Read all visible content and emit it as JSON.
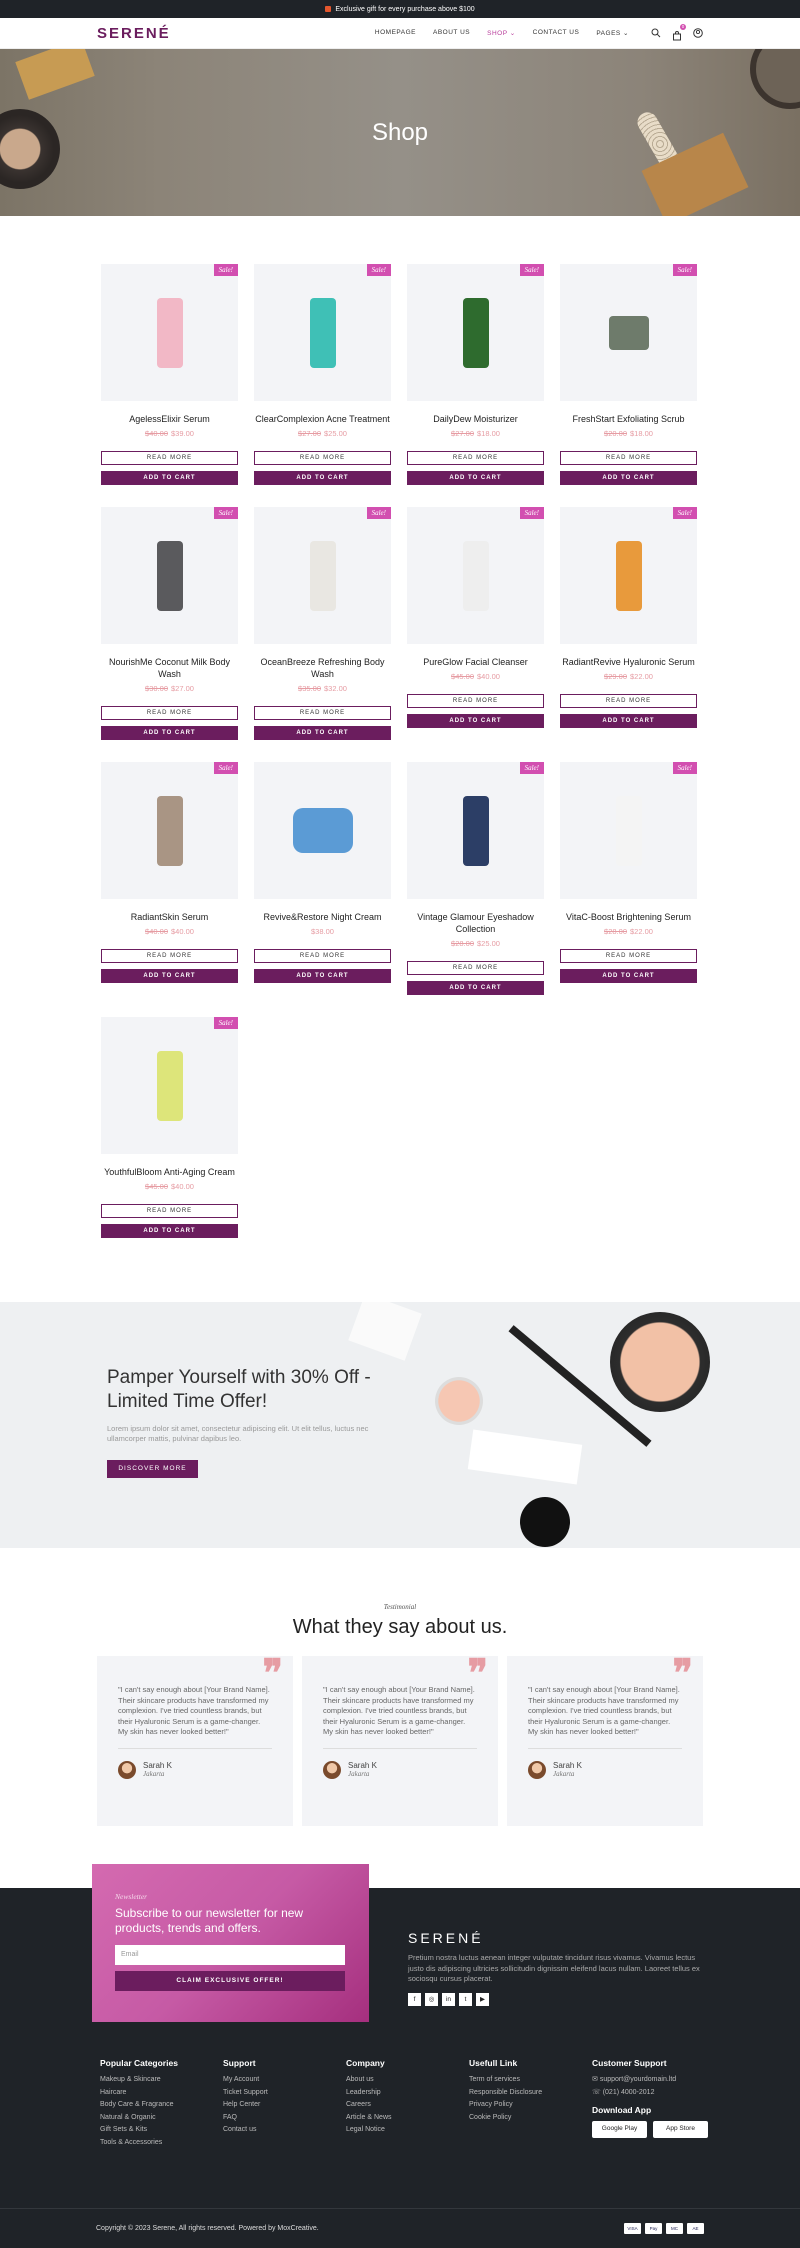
{
  "topbar": {
    "text": "Exclusive gift for every purchase above $100"
  },
  "header": {
    "logo": "SERENÉ",
    "nav": [
      "HOMEPAGE",
      "ABOUT US",
      "SHOP ⌄",
      "CONTACT US",
      "PAGES ⌄"
    ],
    "active_index": 2,
    "cart_count": "0"
  },
  "hero": {
    "title": "Shop"
  },
  "products": [
    {
      "name": "AgelessElixir Serum",
      "old": "$40.00",
      "price": "$39.00",
      "color": "#f2b8c6",
      "sale": "Sale!"
    },
    {
      "name": "ClearComplexion Acne Treatment",
      "old": "$27.00",
      "price": "$25.00",
      "color": "#3fc0b6",
      "sale": "Sale!"
    },
    {
      "name": "DailyDew Moisturizer",
      "old": "$27.00",
      "price": "$18.00",
      "color": "#2e6b2e",
      "sale": "Sale!"
    },
    {
      "name": "FreshStart Exfoliating Scrub",
      "old": "$20.00",
      "price": "$18.00",
      "color": "#6e7b6b",
      "sale": "Sale!"
    },
    {
      "name": "NourishMe Coconut Milk Body Wash",
      "old": "$30.00",
      "price": "$27.00",
      "color": "#5a5a5d",
      "sale": "Sale!"
    },
    {
      "name": "OceanBreeze Refreshing Body Wash",
      "old": "$35.00",
      "price": "$32.00",
      "color": "#e9e7e2",
      "sale": "Sale!"
    },
    {
      "name": "PureGlow Facial Cleanser",
      "old": "$45.00",
      "price": "$40.00",
      "color": "#eeeeee",
      "sale": "Sale!"
    },
    {
      "name": "RadiantRevive Hyaluronic Serum",
      "old": "$29.00",
      "price": "$22.00",
      "color": "#e89a3c",
      "sale": "Sale!"
    },
    {
      "name": "RadiantSkin Serum",
      "old": "$40.00",
      "price": "$40.00",
      "color": "#a99584",
      "sale": "Sale!"
    },
    {
      "name": "Revive&Restore Night Cream",
      "old": "",
      "price": "$38.00",
      "color": "#5b9bd5",
      "sale": ""
    },
    {
      "name": "Vintage Glamour Eyeshadow Collection",
      "old": "$28.00",
      "price": "$25.00",
      "color": "#2c3e66",
      "sale": "Sale!"
    },
    {
      "name": "VitaC-Boost Brightening Serum",
      "old": "$28.00",
      "price": "$22.00",
      "color": "#f4f4f4",
      "sale": "Sale!"
    },
    {
      "name": "YouthfulBloom Anti-Aging Cream",
      "old": "$45.00",
      "price": "$40.00",
      "color": "#dde57a",
      "sale": "Sale!"
    }
  ],
  "buttons": {
    "read_more": "READ MORE",
    "add_to_cart": "ADD TO CART"
  },
  "promo": {
    "title": "Pamper Yourself with 30% Off - Limited Time Offer!",
    "text": "Lorem ipsum dolor sit amet, consectetur adipiscing elit. Ut elit tellus, luctus nec ullamcorper mattis, pulvinar dapibus leo.",
    "button": "DISCOVER MORE"
  },
  "testimonials": {
    "label": "Testimonial",
    "title": "What they say about us.",
    "items": [
      {
        "text": "\"I can't say enough about [Your Brand Name]. Their skincare products have transformed my complexion. I've tried countless brands, but their Hyaluronic Serum is a game-changer. My skin has never looked better!\"",
        "name": "Sarah K",
        "city": "Jakarta"
      },
      {
        "text": "\"I can't say enough about [Your Brand Name]. Their skincare products have transformed my complexion. I've tried countless brands, but their Hyaluronic Serum is a game-changer. My skin has never looked better!\"",
        "name": "Sarah K",
        "city": "Jakarta"
      },
      {
        "text": "\"I can't say enough about [Your Brand Name]. Their skincare products have transformed my complexion. I've tried countless brands, but their Hyaluronic Serum is a game-changer. My skin has never looked better!\"",
        "name": "Sarah K",
        "city": "Jakarta"
      }
    ]
  },
  "newsletter": {
    "label": "Newsletter",
    "title": "Subscribe to our newsletter for new products, trends and offers.",
    "placeholder": "Email",
    "button": "CLAIM EXCLUSIVE OFFER!"
  },
  "footer_brand": {
    "logo": "SERENÉ",
    "text": "Pretium nostra luctus aenean integer vulputate tincidunt risus vivamus. Vivamus lectus justo dis adipiscing ultricies sollicitudin dignissim eleifend lacus nullam. Laoreet tellus ex sociosqu cursus placerat.",
    "socials": [
      "f",
      "◎",
      "in",
      "t",
      "▶"
    ]
  },
  "footer_cols": [
    {
      "title": "Popular Categories",
      "items": [
        "Makeup & Skincare",
        "Haircare",
        "Body Care & Fragrance",
        "Natural & Organic",
        "Gift Sets & Kits",
        "Tools & Accessories"
      ]
    },
    {
      "title": "Support",
      "items": [
        "My Account",
        "Ticket Support",
        "Help Center",
        "FAQ",
        "Contact us"
      ]
    },
    {
      "title": "Company",
      "items": [
        "About us",
        "Leadership",
        "Careers",
        "Article & News",
        "Legal Notice"
      ]
    },
    {
      "title": "Usefull Link",
      "items": [
        "Term of services",
        "Responsible Disclosure",
        "Privacy Policy",
        "Cookie Policy"
      ]
    }
  ],
  "customer_support": {
    "title": "Customer Support",
    "email": "support@yourdomain.ltd",
    "phone": "(021) 4000-2012",
    "download": "Download App",
    "google": "Google Play",
    "apple": "App Store"
  },
  "copyright": "Copyright © 2023 Serene, All rights reserved. Powered by MoxCreative.",
  "payment_cards": [
    "VISA",
    "Pay",
    "MC",
    "AE"
  ]
}
